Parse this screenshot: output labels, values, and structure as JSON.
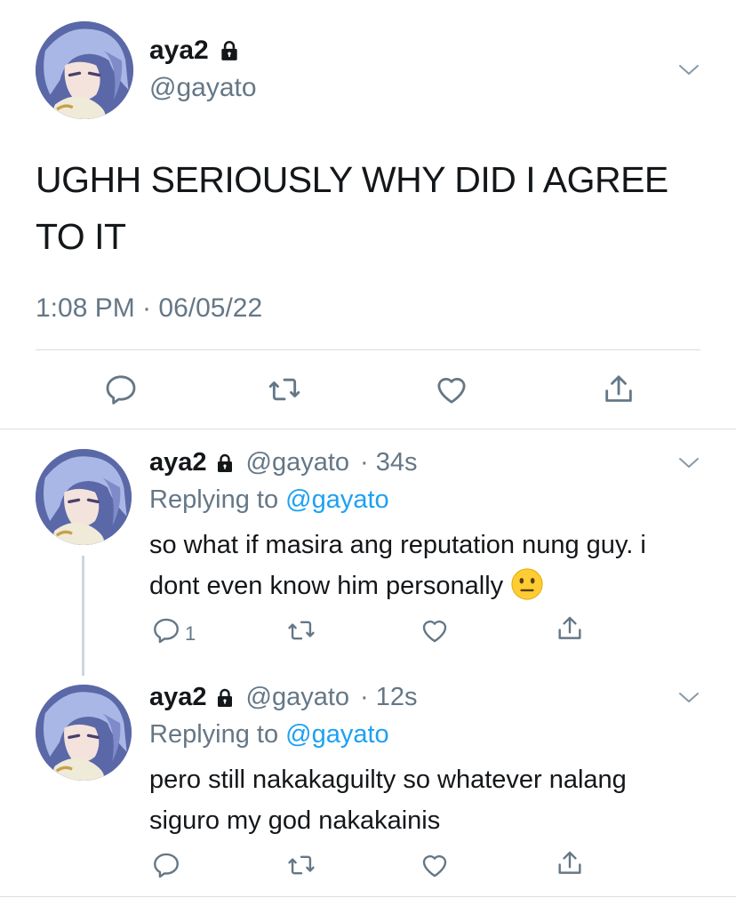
{
  "main_tweet": {
    "display_name": "aya2",
    "handle": "@gayato",
    "text": "UGHH SERIOUSLY WHY DID I AGREE TO IT",
    "timestamp": "1:08 PM · 06/05/22"
  },
  "replies": [
    {
      "display_name": "aya2",
      "handle": "@gayato",
      "age": "· 34s",
      "replying_prefix": "Replying to ",
      "replying_to": "@gayato",
      "text": "so what if masira ang reputation nung guy. i dont even know him personally",
      "emoji": "neutral-face",
      "reply_count": "1"
    },
    {
      "display_name": "aya2",
      "handle": "@gayato",
      "age": "· 12s",
      "replying_prefix": "Replying to ",
      "replying_to": "@gayato",
      "text": "pero still nakakaguilty so whatever nalang siguro my god nakakainis",
      "reply_count": ""
    }
  ],
  "icons": {
    "reply": "reply-icon",
    "retweet": "retweet-icon",
    "like": "heart-icon",
    "share": "share-icon",
    "lock": "lock-icon",
    "more": "chevron-down-icon"
  },
  "colors": {
    "link": "#1da1f2",
    "secondary": "#657786",
    "icon": "#657786",
    "divider": "#d9dee2"
  }
}
